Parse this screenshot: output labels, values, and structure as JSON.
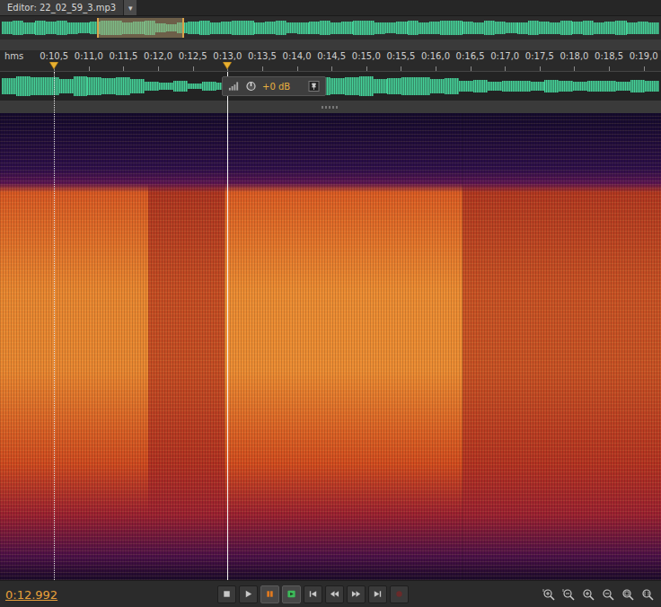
{
  "editor": {
    "title": "Editor: 22_02_59_3.mp3",
    "menu": "▾"
  },
  "overview": {
    "range_start": 0.147,
    "range_end": 0.279,
    "levels": [
      0.55,
      0.6,
      0.5,
      0.65,
      0.55,
      0.6,
      0.5,
      0.45,
      0.55,
      0.6,
      0.65,
      0.5,
      0.55,
      0.6,
      0.35,
      0.3,
      0.45,
      0.55,
      0.6,
      0.5,
      0.55,
      0.65,
      0.6,
      0.5,
      0.55,
      0.6,
      0.45,
      0.5,
      0.55,
      0.6,
      0.5,
      0.55,
      0.65,
      0.6,
      0.5,
      0.45,
      0.55,
      0.6,
      0.5,
      0.55,
      0.6,
      0.65,
      0.55,
      0.5,
      0.6,
      0.55,
      0.45,
      0.5,
      0.6,
      0.55,
      0.5,
      0.6,
      0.55,
      0.65,
      0.5,
      0.55,
      0.6,
      0.5,
      0.55,
      0.5
    ]
  },
  "ruler": {
    "unit": "hms",
    "start": 9.72,
    "end": 19.25,
    "ticks": [
      {
        "label": "0:10,5",
        "time": 10.5
      },
      {
        "label": "0:11,0",
        "time": 11.0
      },
      {
        "label": "0:11,5",
        "time": 11.5
      },
      {
        "label": "0:12,0",
        "time": 12.0
      },
      {
        "label": "0:12,5",
        "time": 12.5
      },
      {
        "label": "0:13,0",
        "time": 13.0
      },
      {
        "label": "0:13,5",
        "time": 13.5
      },
      {
        "label": "0:14,0",
        "time": 14.0
      },
      {
        "label": "0:14,5",
        "time": 14.5
      },
      {
        "label": "0:15,0",
        "time": 15.0
      },
      {
        "label": "0:15,5",
        "time": 15.5
      },
      {
        "label": "0:16,0",
        "time": 16.0
      },
      {
        "label": "0:16,5",
        "time": 16.5
      },
      {
        "label": "0:17,0",
        "time": 17.0
      },
      {
        "label": "0:17,5",
        "time": 17.5
      },
      {
        "label": "0:18,0",
        "time": 18.0
      },
      {
        "label": "0:18,5",
        "time": 18.5
      },
      {
        "label": "0:19,0",
        "time": 19.0
      }
    ]
  },
  "markers": [
    {
      "kind": "marker",
      "time": 10.5
    },
    {
      "kind": "playhead",
      "time": 12.992
    }
  ],
  "waveform": {
    "levels": [
      0.55,
      0.7,
      0.6,
      0.65,
      0.5,
      0.7,
      0.6,
      0.55,
      0.65,
      0.5,
      0.3,
      0.25,
      0.35,
      0.2,
      0.3,
      0.25,
      0.6,
      0.65,
      0.55,
      0.7,
      0.6,
      0.5,
      0.65,
      0.55,
      0.6,
      0.7,
      0.5,
      0.55,
      0.65,
      0.6,
      0.5,
      0.55,
      0.35,
      0.45,
      0.3,
      0.4,
      0.35,
      0.3,
      0.45,
      0.4,
      0.3,
      0.35,
      0.4,
      0.3,
      0.45,
      0.35
    ]
  },
  "hud": {
    "reading": "+0 dB"
  },
  "spectrogram": {
    "segments": [
      {
        "from": 9.72,
        "to": 11.86,
        "level": 0.85
      },
      {
        "from": 11.86,
        "to": 12.96,
        "level": 0.3
      },
      {
        "from": 12.96,
        "to": 16.39,
        "level": 0.9
      },
      {
        "from": 16.39,
        "to": 19.25,
        "level": 0.35
      }
    ]
  },
  "status": {
    "time": "0:12.992"
  },
  "transport": [
    {
      "kind": "stop",
      "color": "#c8c8c8",
      "active": false
    },
    {
      "kind": "play",
      "color": "#c8c8c8",
      "active": false
    },
    {
      "kind": "pause",
      "color": "#e07a20",
      "active": true
    },
    {
      "kind": "loop",
      "color": "#3dbb5a",
      "active": true
    },
    {
      "kind": "skip-start",
      "color": "#c8c8c8",
      "active": false
    },
    {
      "kind": "rewind",
      "color": "#c8c8c8",
      "active": false
    },
    {
      "kind": "forward",
      "color": "#c8c8c8",
      "active": false
    },
    {
      "kind": "skip-end",
      "color": "#c8c8c8",
      "active": false
    },
    {
      "kind": "record",
      "color": "#6a2a2a",
      "active": false
    }
  ],
  "zoom": [
    {
      "kind": "zoom-in-amplitude"
    },
    {
      "kind": "zoom-out-amplitude"
    },
    {
      "kind": "zoom-in-time"
    },
    {
      "kind": "zoom-out-time"
    },
    {
      "kind": "zoom-full"
    },
    {
      "kind": "zoom-selection"
    }
  ]
}
